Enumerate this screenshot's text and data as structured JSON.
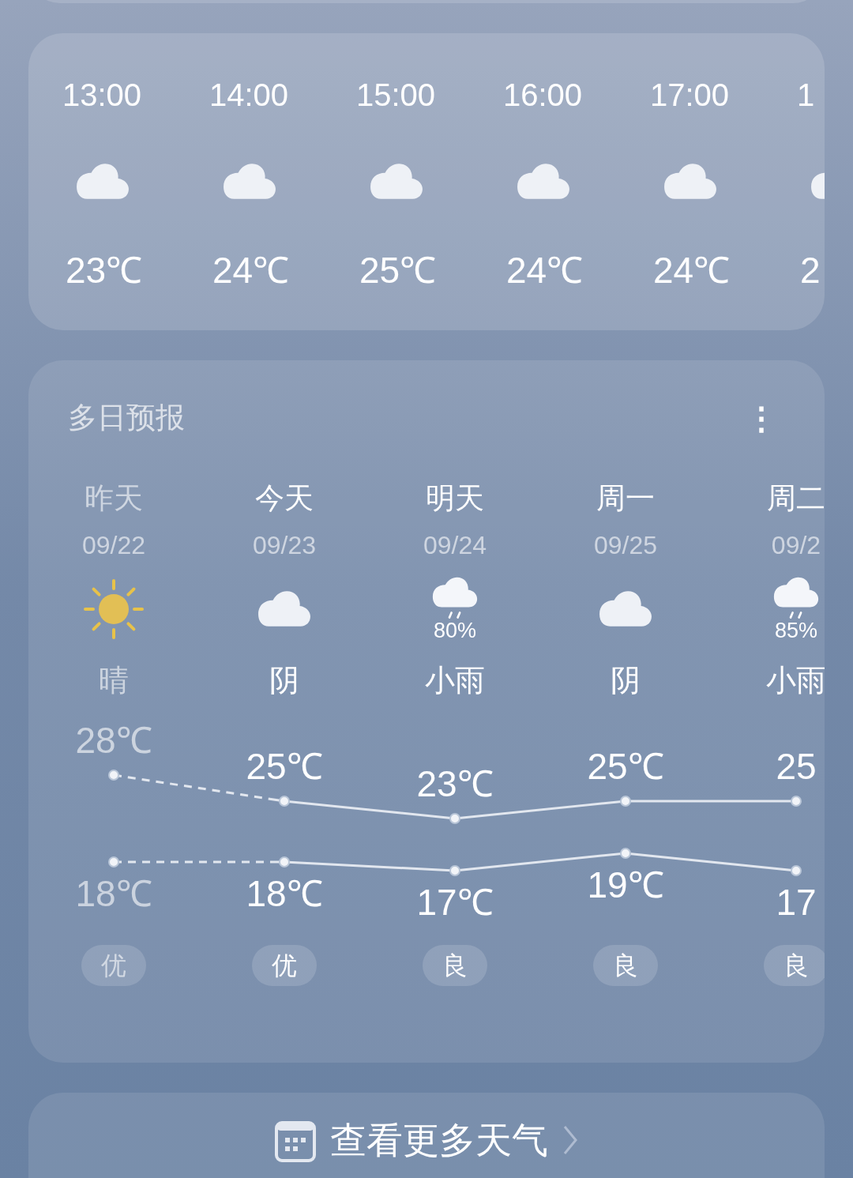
{
  "hourly": [
    {
      "time": "13:00",
      "kind": "cloudy",
      "temp": "23℃"
    },
    {
      "time": "14:00",
      "kind": "cloudy",
      "temp": "24℃"
    },
    {
      "time": "15:00",
      "kind": "cloudy",
      "temp": "25℃"
    },
    {
      "time": "16:00",
      "kind": "cloudy",
      "temp": "24℃"
    },
    {
      "time": "17:00",
      "kind": "cloudy",
      "temp": "24℃"
    },
    {
      "time": "1",
      "kind": "cloudy",
      "temp": "2"
    }
  ],
  "daily": {
    "title": "多日预报",
    "more": "⋮",
    "days": [
      {
        "day": "昨天",
        "date": "09/22",
        "kind": "sunny",
        "desc": "晴",
        "aqi": "优",
        "past": true
      },
      {
        "day": "今天",
        "date": "09/23",
        "kind": "cloudy",
        "desc": "阴",
        "aqi": "优",
        "past": false
      },
      {
        "day": "明天",
        "date": "09/24",
        "kind": "rain",
        "precip": "80%",
        "desc": "小雨",
        "aqi": "良",
        "past": false
      },
      {
        "day": "周一",
        "date": "09/25",
        "kind": "cloudy",
        "desc": "阴",
        "aqi": "良",
        "past": false
      },
      {
        "day": "周二",
        "date": "09/2",
        "kind": "rain",
        "precip": "85%",
        "desc": "小雨",
        "aqi": "良",
        "past": false
      }
    ],
    "chart_data": {
      "type": "line",
      "categories": [
        null,
        null,
        null,
        null,
        null
      ],
      "series": [
        {
          "color": "#e2e7ef",
          "line_style": "dashed_start",
          "marker": "circle",
          "values": [
            28,
            25,
            23,
            25,
            25
          ],
          "value_labels": [
            "28℃",
            "25℃",
            "23℃",
            "25℃",
            "25"
          ]
        },
        {
          "color": "#e2e7ef",
          "line_style": "dashed_start",
          "marker": "circle",
          "values": [
            18,
            18,
            17,
            19,
            17
          ],
          "value_labels": [
            "18℃",
            "18℃",
            "17℃",
            "19℃",
            "17"
          ]
        }
      ]
    }
  },
  "footer": {
    "label": "查看更多天气"
  }
}
